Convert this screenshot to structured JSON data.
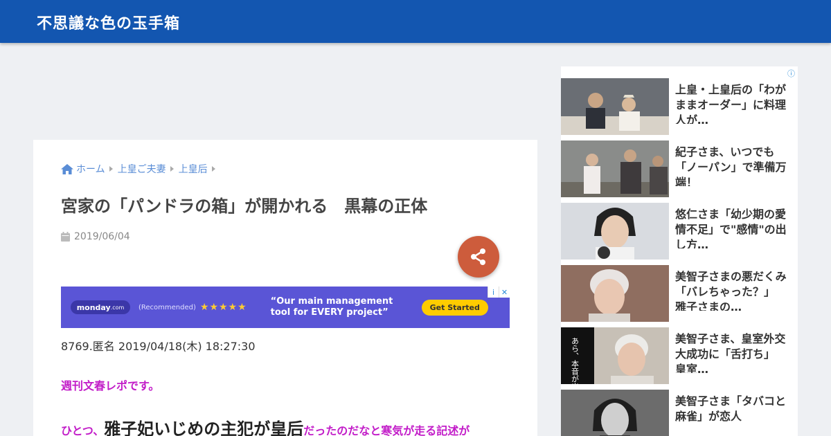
{
  "header": {
    "site_title": "不思議な色の玉手箱"
  },
  "breadcrumb": [
    "ホーム",
    "上皇ご夫妻",
    "上皇后"
  ],
  "post": {
    "title": "宮家の「パンドラの箱」が開かれる　黒幕の正体",
    "date": "2019/06/04"
  },
  "ad": {
    "brand": "monday",
    "brand_suffix": ".com",
    "recommended": "(Recommended)",
    "headline": "“Our main management tool for EVERY project”",
    "cta": "Get Started"
  },
  "content": {
    "meta": "8769.匿名 2019/04/18(木) 18:27:30",
    "source": "週刊文春レポです。",
    "line_prefix": "ひとつ、",
    "line_big": "雅子妃いじめの主犯が皇后",
    "line_suffix": "だったのだなと寒気が走る記述が"
  },
  "sidebar": {
    "items": [
      {
        "title": "上皇・上皇后の「わがままオーダー」に料理人が…"
      },
      {
        "title": "紀子さま、いつでも「ノーパン」で準備万端！"
      },
      {
        "title": "悠仁さま「幼少期の愛情不足」で\"感情\"の出し方…"
      },
      {
        "title": "美智子さまの悪だくみ「バレちゃった？」　雅子さまの…"
      },
      {
        "title": "美智子さま、皇室外交大成功に「舌打ち」　皇室…"
      },
      {
        "title": "美智子さま「タバコと麻雀」が恋人"
      }
    ],
    "thumb_overlay_text": "あら、本音が出ちゃったわ"
  },
  "colors": {
    "header_bg": "#1356b0",
    "accent": "#5a8dd6",
    "share_button": "#cd5c3c",
    "highlight_text": "#c21cc8",
    "ad_bg": "#5a55d6"
  }
}
